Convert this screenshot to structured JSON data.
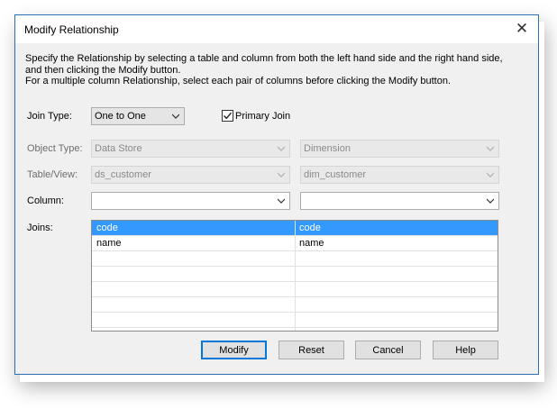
{
  "dialog": {
    "title": "Modify Relationship",
    "close_glyph": "✕",
    "description": [
      "Specify the Relationship by selecting a table and column from both the left hand side and the right hand side,",
      "and then clicking the Modify button.",
      "For a multiple column Relationship, select each pair of columns before clicking the Modify button."
    ]
  },
  "join_type": {
    "label": "Join Type:",
    "value": "One to One",
    "primary_join_label": "Primary Join",
    "primary_join_checked": true
  },
  "object_type": {
    "label": "Object Type:",
    "left_value": "Data Store",
    "right_value": "Dimension"
  },
  "table_view": {
    "label": "Table/View:",
    "left_value": "ds_customer",
    "right_value": "dim_customer"
  },
  "column": {
    "label": "Column:",
    "left_value": "",
    "right_value": ""
  },
  "joins": {
    "label": "Joins:",
    "rows": [
      {
        "left": "code",
        "right": "code",
        "selected": true
      },
      {
        "left": "name",
        "right": "name",
        "selected": false
      }
    ]
  },
  "buttons": {
    "modify": "Modify",
    "reset": "Reset",
    "cancel": "Cancel",
    "help": "Help"
  },
  "icons": {
    "close": "close-icon",
    "dropdown": "chevron-down-icon",
    "check": "checkmark-icon"
  },
  "colors": {
    "window_border": "#2b6fb6",
    "selection": "#3399ff",
    "default_button_border": "#0078d7"
  }
}
